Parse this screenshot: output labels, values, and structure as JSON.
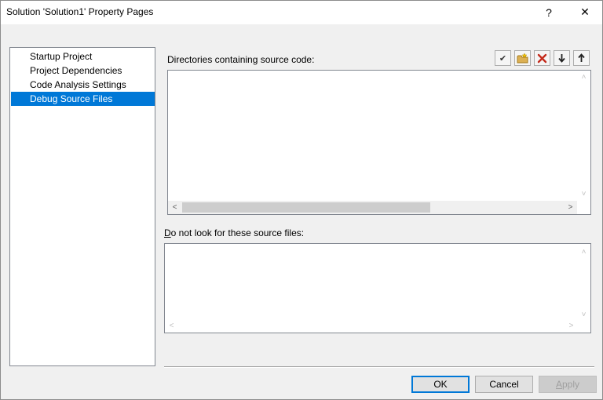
{
  "window": {
    "title": "Solution 'Solution1' Property Pages",
    "help_glyph": "?",
    "close_glyph": "✕"
  },
  "nav": {
    "items": [
      {
        "label": "Startup Project",
        "selected": false
      },
      {
        "label": "Project Dependencies",
        "selected": false
      },
      {
        "label": "Code Analysis Settings",
        "selected": false
      },
      {
        "label": "Debug Source Files",
        "selected": true
      }
    ]
  },
  "source_dirs": {
    "label": "Directories containing source code:",
    "toolbar": [
      {
        "icon": "checkmark-icon",
        "glyph": "✔",
        "color": "#333333"
      },
      {
        "icon": "new-folder-icon",
        "glyph": "📁",
        "color": "#d9a440"
      },
      {
        "icon": "delete-icon",
        "glyph": "✕",
        "color": "#c42b1c"
      },
      {
        "icon": "move-down-icon",
        "glyph": "🡣",
        "color": "#333333"
      },
      {
        "icon": "move-up-icon",
        "glyph": "🡡",
        "color": "#333333"
      }
    ]
  },
  "exclude_files": {
    "label_prefix": "",
    "label_accel": "D",
    "label_rest": "o not look for these source files:"
  },
  "buttons": {
    "ok": "OK",
    "cancel": "Cancel",
    "apply_accel": "A",
    "apply_rest": "pply"
  },
  "scroll_glyphs": {
    "up": "˄",
    "down": "˅",
    "left": "<",
    "right": ">"
  }
}
